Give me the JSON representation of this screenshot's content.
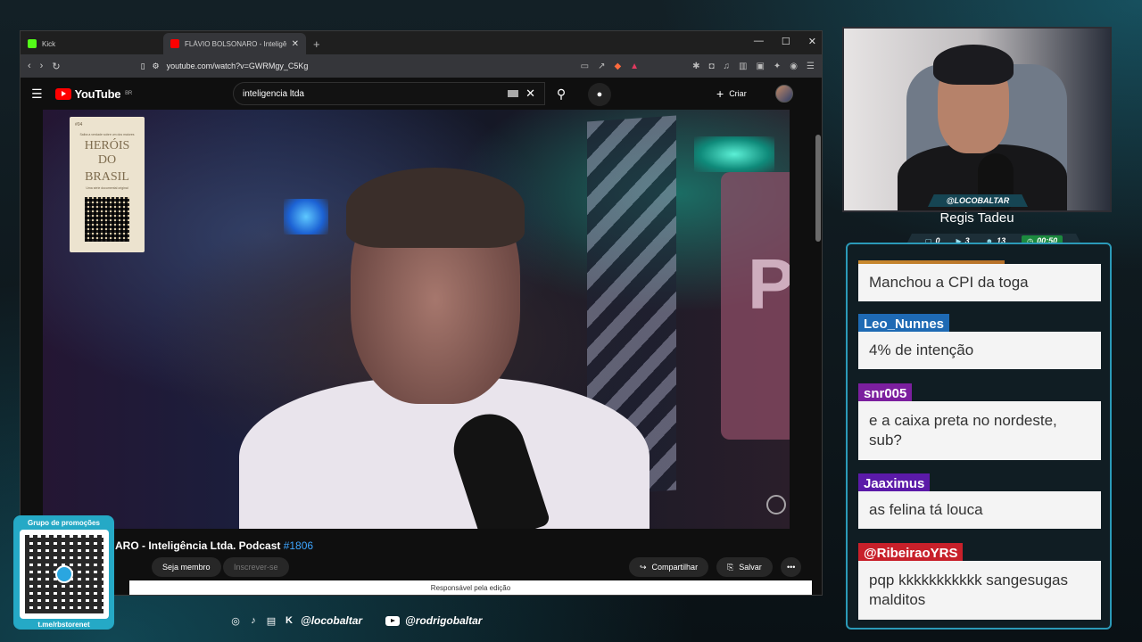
{
  "browser": {
    "tabs": [
      {
        "title": "Kick",
        "fav_color": "#53fc18",
        "active": false
      },
      {
        "title": "FLÁVIO BOLSONARO - Inteligência Ltda.",
        "fav_color": "#ff0000",
        "active": true
      }
    ],
    "url": "youtube.com/watch?v=GWRMgy_C5Kg"
  },
  "youtube": {
    "logo": "YouTube",
    "region": "BR",
    "search_value": "inteligencia ltda",
    "create_label": "Criar",
    "video_title_main": "ARO - Inteligência Ltda. Podcast ",
    "video_title_hash": "#1806",
    "join_label": "Seja membro",
    "subscribe_label": "Inscrever-se",
    "share_label": "Compartilhar",
    "save_label": "Salvar",
    "banner_text": "Responsável pela edição",
    "poster": {
      "episode": "#04",
      "tagline": "Saiba a verdade sobre um dos maiores",
      "title_line1": "HERÓIS DO",
      "title_line2": "BRASIL",
      "subtitle": "Uma série documental original"
    },
    "video_sign_text": "PA"
  },
  "overlay": {
    "promo_title": "Grupo de promoções",
    "promo_url": "t.me/rbstorenet",
    "social_handle_1": "@locobaltar",
    "social_handle_2": "@rodrigobaltar",
    "cam_handle": "@LOCOBALTAR",
    "streamer_name": "Regis Tadeu",
    "stats": {
      "chat": "0",
      "viewers": "3",
      "followers": "13",
      "time": "00:50"
    }
  },
  "chat": {
    "first_message": "Manchou a CPI da toga",
    "messages": [
      {
        "user": "Leo_Nunnes",
        "color": "#1e6ab4",
        "text": "4% de intenção"
      },
      {
        "user": "snr005",
        "color": "#7b1f9e",
        "text": "e a caixa preta no nordeste, sub?"
      },
      {
        "user": "Jaaximus",
        "color": "#5b1aa8",
        "text": "as felina tá louca"
      },
      {
        "user": "@RibeiraoYRS",
        "color": "#c8202a",
        "text": "pqp kkkkkkkkkkk sangesugas malditos"
      }
    ]
  },
  "colors": {
    "accent": "#2b9ab8",
    "youtube_red": "#ff0000",
    "link_blue": "#3ea6ff"
  }
}
